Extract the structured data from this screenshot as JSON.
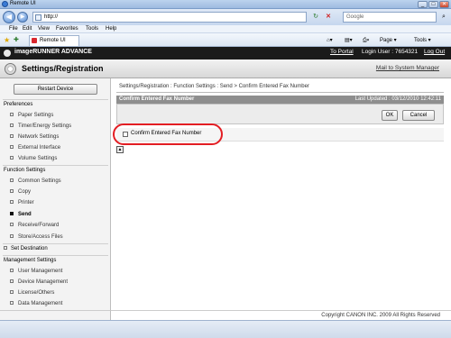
{
  "browser": {
    "window_title": "Remote UI",
    "window_buttons": [
      "_",
      "□",
      "✕"
    ],
    "address": "http://",
    "refresh_label": "↻",
    "stop_label": "✕",
    "search_placeholder": "Google",
    "menu": [
      "File",
      "Edit",
      "View",
      "Favorites",
      "Tools",
      "Help"
    ],
    "tab_label": "Remote UI",
    "tools": [
      "Page ▾",
      "Tools ▾"
    ]
  },
  "app": {
    "product": "imageRUNNER ADVANCE",
    "to_portal": "To Portal",
    "login_user": "Login User : 7654321",
    "logout": "Log Out",
    "page_title": "Settings/Registration",
    "mail_admin": "Mail to System Manager"
  },
  "sidebar": {
    "restart": "Restart Device",
    "sections": {
      "preferences": "Preferences",
      "function_settings": "Function Settings",
      "set_destination": "Set Destination",
      "management_settings": "Management Settings"
    },
    "items": [
      "Paper Settings",
      "Timer/Energy Settings",
      "Network Settings",
      "External Interface",
      "Volume Settings",
      "Common Settings",
      "Copy",
      "Printer",
      "Send",
      "Receive/Forward",
      "Store/Access Files",
      "User Management",
      "Device Management",
      "License/Others",
      "Data Management"
    ]
  },
  "main": {
    "breadcrumb": "Settings/Registration : Function Settings : Send > Confirm Entered Fax Number",
    "panel_title": "Confirm Entered Fax Number",
    "last_updated": "Last Updated : 03/12/2010 12:42:11",
    "ok": "OK",
    "cancel": "Cancel",
    "checkbox_label": "Confirm Entered Fax Number",
    "checkbox_checked": false,
    "top_icon": "▲"
  },
  "footer": {
    "copyright": "Copyright CANON INC. 2009 All Rights Reserved"
  },
  "colors": {
    "highlight": "#e31d23",
    "app_bar": "#1b1b1b"
  }
}
